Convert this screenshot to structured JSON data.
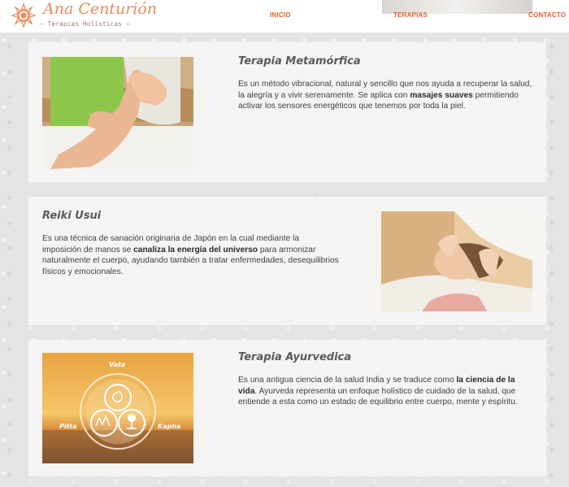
{
  "header": {
    "logo": {
      "name": "Ana Centurión",
      "tagline": "— Terapias Holísticas —"
    },
    "nav": {
      "inicio": "INICIO",
      "terapias": "TERAPIAS",
      "contacto": "CONTACTO"
    }
  },
  "colors": {
    "accent": "#e35f2a",
    "logo": "#e88a5a",
    "card_bg": "#f5f4f3",
    "title": "#5a5a5a"
  },
  "cards": [
    {
      "title": "Terapia Metamórfica",
      "text_1": "Es un método vibracional, natural y sencillo que nos ayuda a recuperar la salud, la alegría y a vivir serenamente. Se aplica con ",
      "bold": "masajes suaves",
      "text_2": " permitiendo activar los sensores energéticos que tenemos por toda la piel.",
      "image": "foot-massage-photo"
    },
    {
      "title": "Reiki Usui",
      "text_1": "Es una técnica de sanación originaria de Japón en la cual mediante la imposición de manos se ",
      "bold": "canaliza la energía del universo",
      "text_2": " para armonizar naturalmente el cuerpo, ayudando también a tratar enfermedades, desequilibrios físicos y emocionales.",
      "image": "reiki-session-photo"
    },
    {
      "title": "Terapia Ayurvedica",
      "text_1": "Es una antigua ciencia de la salud India y se traduce como ",
      "bold": "la ciencia de la vida",
      "text_2": ". Ayurveda representa un enfoque holístico de cuidado de la salud, que entiende a esta como un estado de equilibrio entre cuerpo, mente y espíritu.",
      "image": "doshas-sunset-graphic",
      "doshas": {
        "top": "Vata",
        "left": "Pitta",
        "right": "Kapha"
      }
    }
  ]
}
